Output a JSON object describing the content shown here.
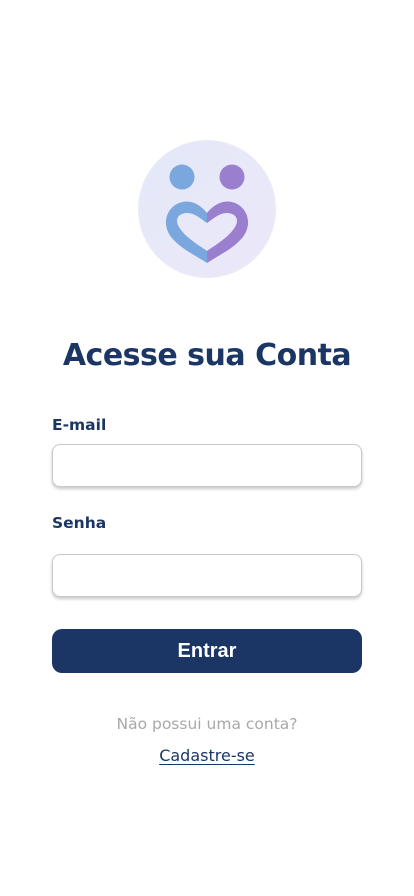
{
  "login": {
    "title": "Acesse sua Conta",
    "email_label": "E-mail",
    "email_value": "",
    "email_placeholder": "",
    "password_label": "Senha",
    "password_value": "",
    "password_placeholder": "",
    "submit_label": "Entrar",
    "no_account_text": "Não possui uma conta?",
    "signup_link_label": "Cadastre-se"
  },
  "logo": {
    "icon": "two-people-heart-icon",
    "colors": {
      "left_figure": "#7aa7de",
      "right_figure": "#9b7fcf",
      "background": "#e6e8f8"
    }
  },
  "theme": {
    "primary": "#1b3664",
    "muted_text": "#a8a8a8",
    "background": "#ffffff"
  }
}
